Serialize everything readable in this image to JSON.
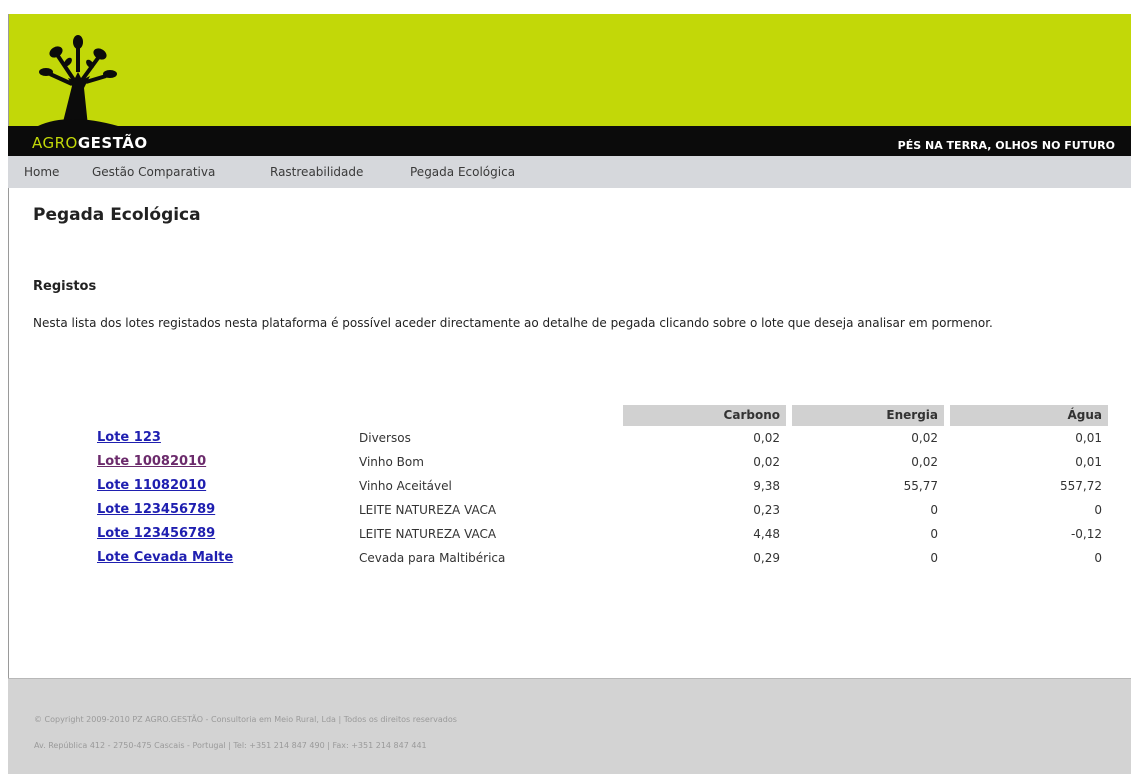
{
  "header": {
    "brand_prefix": "AGRO",
    "brand_suffix": "GESTÃO",
    "slogan": "PÉS NA TERRA, OLHOS NO FUTURO",
    "logo_icon": "tree-logo-icon",
    "colors": {
      "band": "#c2d808",
      "bar": "#0b0b0b"
    }
  },
  "nav": {
    "items": [
      {
        "label": "Home"
      },
      {
        "label": "Gestão Comparativa"
      },
      {
        "label": "Rastreabilidade"
      },
      {
        "label": "Pegada Ecológica"
      }
    ]
  },
  "main": {
    "title": "Pegada Ecológica",
    "section_title": "Registos",
    "intro": "Nesta lista dos lotes registados nesta plataforma é possível aceder directamente ao detalhe de pegada clicando sobre o lote que deseja analisar em pormenor.",
    "table": {
      "columns": [
        "Carbono",
        "Energia",
        "Água"
      ],
      "rows": [
        {
          "lot": "Lote 123",
          "product": "Diversos",
          "carbono": "0,02",
          "energia": "0,02",
          "agua": "0,01",
          "visited": false
        },
        {
          "lot": "Lote 10082010",
          "product": "Vinho Bom",
          "carbono": "0,02",
          "energia": "0,02",
          "agua": "0,01",
          "visited": true
        },
        {
          "lot": "Lote 11082010",
          "product": "Vinho Aceitável",
          "carbono": "9,38",
          "energia": "55,77",
          "agua": "557,72",
          "visited": false
        },
        {
          "lot": "Lote 123456789",
          "product": "LEITE NATUREZA VACA",
          "carbono": "0,23",
          "energia": "0",
          "agua": "0",
          "visited": false
        },
        {
          "lot": "Lote 123456789",
          "product": "LEITE NATUREZA VACA",
          "carbono": "4,48",
          "energia": "0",
          "agua": "-0,12",
          "visited": false
        },
        {
          "lot": "Lote Cevada Malte",
          "product": "Cevada para Maltibérica",
          "carbono": "0,29",
          "energia": "0",
          "agua": "0",
          "visited": false
        }
      ]
    }
  },
  "footer": {
    "line1": "© Copyright 2009-2010 PZ AGRO.GESTÃO - Consultoria em Meio Rural, Lda | Todos os direitos reservados",
    "line2": "Av. República 412 - 2750-475 Cascais - Portugal    |    Tel: +351 214 847 490    |    Fax: +351 214 847 441"
  }
}
